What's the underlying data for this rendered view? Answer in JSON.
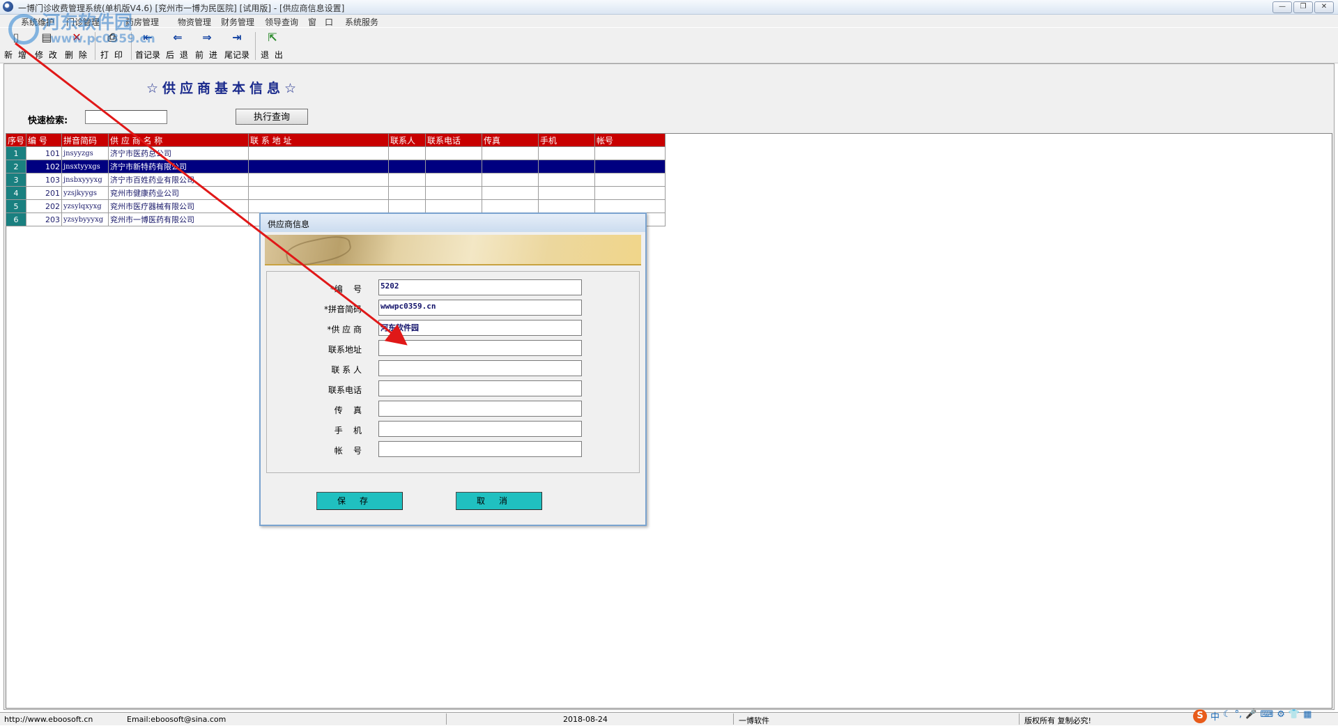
{
  "window": {
    "title": "一博门诊收费管理系统(单机版V4.6)    [兖州市一博为民医院]  [试用版] - [供应商信息设置]",
    "controls": [
      "—",
      "❐",
      "✕"
    ]
  },
  "menu": [
    {
      "label": "系统维护"
    },
    {
      "label": "门诊管理"
    },
    {
      "label": "药房管理"
    },
    {
      "label": "物资管理"
    },
    {
      "label": "财务管理"
    },
    {
      "label": "领导查询"
    },
    {
      "label": "窗　口"
    },
    {
      "label": "系统服务"
    }
  ],
  "watermark": {
    "line1": "河东软件园",
    "line2": "www.pc0359.cn"
  },
  "toolbar": [
    {
      "name": "new-button",
      "icon": "new-doc-icon",
      "glyph": "▯",
      "label": "新 增"
    },
    {
      "name": "edit-button",
      "icon": "edit-icon",
      "glyph": "▤",
      "label": "修 改"
    },
    {
      "name": "delete-button",
      "icon": "delete-icon",
      "glyph": "✕",
      "label": "删 除"
    },
    {
      "name": "print-button",
      "icon": "printer-icon",
      "glyph": "⎙",
      "label": "打 印"
    },
    {
      "name": "first-record-button",
      "icon": "first-arrow-icon",
      "glyph": "⇤",
      "label": "首记录"
    },
    {
      "name": "previous-button",
      "icon": "left-arrow-icon",
      "glyph": "⇐",
      "label": "后 退"
    },
    {
      "name": "next-button",
      "icon": "right-arrow-icon",
      "glyph": "⇒",
      "label": "前 进"
    },
    {
      "name": "last-record-button",
      "icon": "last-arrow-icon",
      "glyph": "⇥",
      "label": "尾记录"
    },
    {
      "name": "exit-button",
      "icon": "exit-door-icon",
      "glyph": "⇱",
      "label": "退 出"
    }
  ],
  "page": {
    "title": "☆供应商基本信息☆",
    "search_label": "快速检索:",
    "search_value": "",
    "query_button": "执行查询"
  },
  "table": {
    "headers": [
      "序号",
      "编 号",
      "拼音简码",
      "供  应  商  名  称",
      "联  系  地  址",
      "联系人",
      "联系电话",
      "传真",
      "手机",
      "帐号"
    ],
    "rows": [
      {
        "seq": "1",
        "code": "101",
        "py": "jnsyyzgs",
        "name": "济宁市医药总公司"
      },
      {
        "seq": "2",
        "code": "102",
        "py": "jnsxtyyxgs",
        "name": "济宁市新特药有限公司"
      },
      {
        "seq": "3",
        "code": "103",
        "py": "jnsbxyyyxg",
        "name": "济宁市百姓药业有限公司"
      },
      {
        "seq": "4",
        "code": "201",
        "py": "yzsjkyygs",
        "name": "兖州市健康药业公司"
      },
      {
        "seq": "5",
        "code": "202",
        "py": "yzsylqxyxg",
        "name": "兖州市医疗器械有限公司"
      },
      {
        "seq": "6",
        "code": "203",
        "py": "yzsybyyyxg",
        "name": "兖州市一博医药有限公司"
      }
    ],
    "selected_row": 2
  },
  "dialog": {
    "title": "供应商信息",
    "fields": [
      {
        "label": "*编    号",
        "value": "5202"
      },
      {
        "label": "*拼音简码",
        "value": "wwwpc0359.cn"
      },
      {
        "label": "*供 应 商",
        "value": "河东软件园"
      },
      {
        "label": "联系地址",
        "value": ""
      },
      {
        "label": "联 系 人",
        "value": ""
      },
      {
        "label": "联系电话",
        "value": ""
      },
      {
        "label": "传    真",
        "value": ""
      },
      {
        "label": "手    机",
        "value": ""
      },
      {
        "label": "帐    号",
        "value": ""
      }
    ],
    "save_label": "保存",
    "cancel_label": "取消"
  },
  "status": {
    "website": "http://www.eboosoft.cn",
    "email": "Email:eboosoft@sina.com",
    "date": "2018-08-24",
    "company": "一博软件",
    "copyright": "版权所有  复制必究!"
  },
  "colors": {
    "header_red": "#c80000",
    "selected_row": "#000080",
    "button_teal": "#20c0c0",
    "seq_teal": "#1a8080",
    "title_blue": "#1a2a8c"
  },
  "tray": [
    "中",
    "☾",
    "°,",
    "🎤",
    "⌨",
    "⚙",
    "👕",
    "▦"
  ]
}
